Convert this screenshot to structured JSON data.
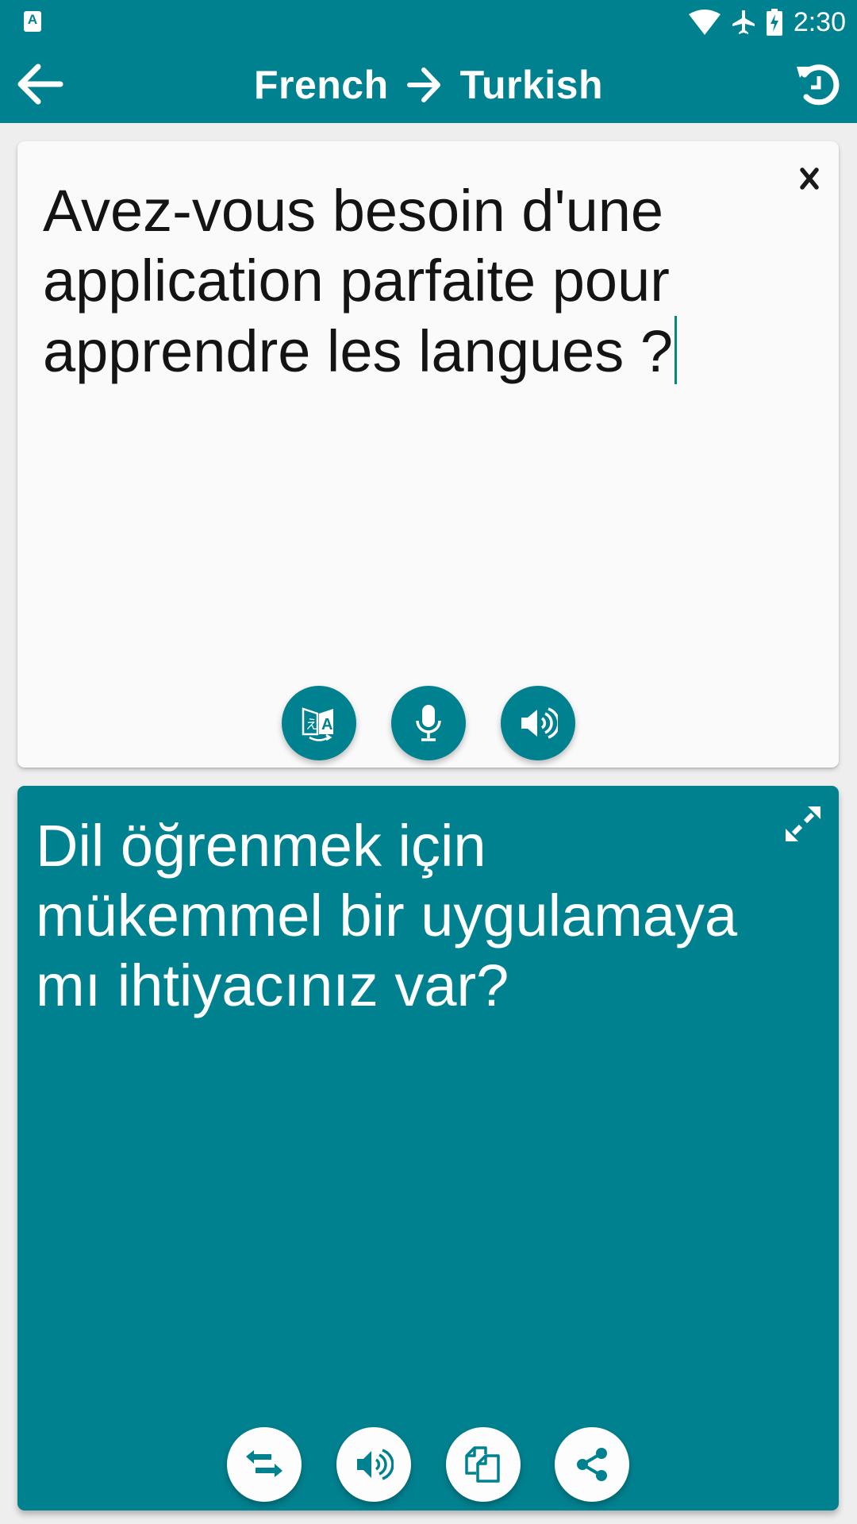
{
  "status_bar": {
    "left_icon": "app-notification-icon",
    "left_icon_letter": "A",
    "icons": [
      "wifi-icon",
      "airplane-mode-icon",
      "battery-charging-icon"
    ],
    "time": "2:30"
  },
  "app_bar": {
    "back_icon": "arrow-back-icon",
    "source_language": "French",
    "arrow_icon": "arrow-right-icon",
    "target_language": "Turkish",
    "history_icon": "history-icon"
  },
  "input_card": {
    "source_text": "Avez-vous besoin d'une application parfaite pour apprendre les langues ?",
    "clear_icon": "close-icon",
    "actions": [
      {
        "name": "translate",
        "icon": "translate-icon"
      },
      {
        "name": "voice-input",
        "icon": "microphone-icon"
      },
      {
        "name": "speak-source",
        "icon": "speaker-icon"
      }
    ]
  },
  "output_card": {
    "translated_text": "Dil öğrenmek için mükemmel bir uygulamaya mı ihtiyacınız var?",
    "expand_icon": "fullscreen-expand-icon",
    "actions": [
      {
        "name": "swap-languages",
        "icon": "swap-icon"
      },
      {
        "name": "speak-translation",
        "icon": "speaker-icon"
      },
      {
        "name": "copy",
        "icon": "copy-icon"
      },
      {
        "name": "share",
        "icon": "share-icon"
      }
    ]
  },
  "colors": {
    "primary": "#00818F",
    "background": "#EEEEEE",
    "card": "#FAFAFA",
    "caret": "#00897B"
  }
}
